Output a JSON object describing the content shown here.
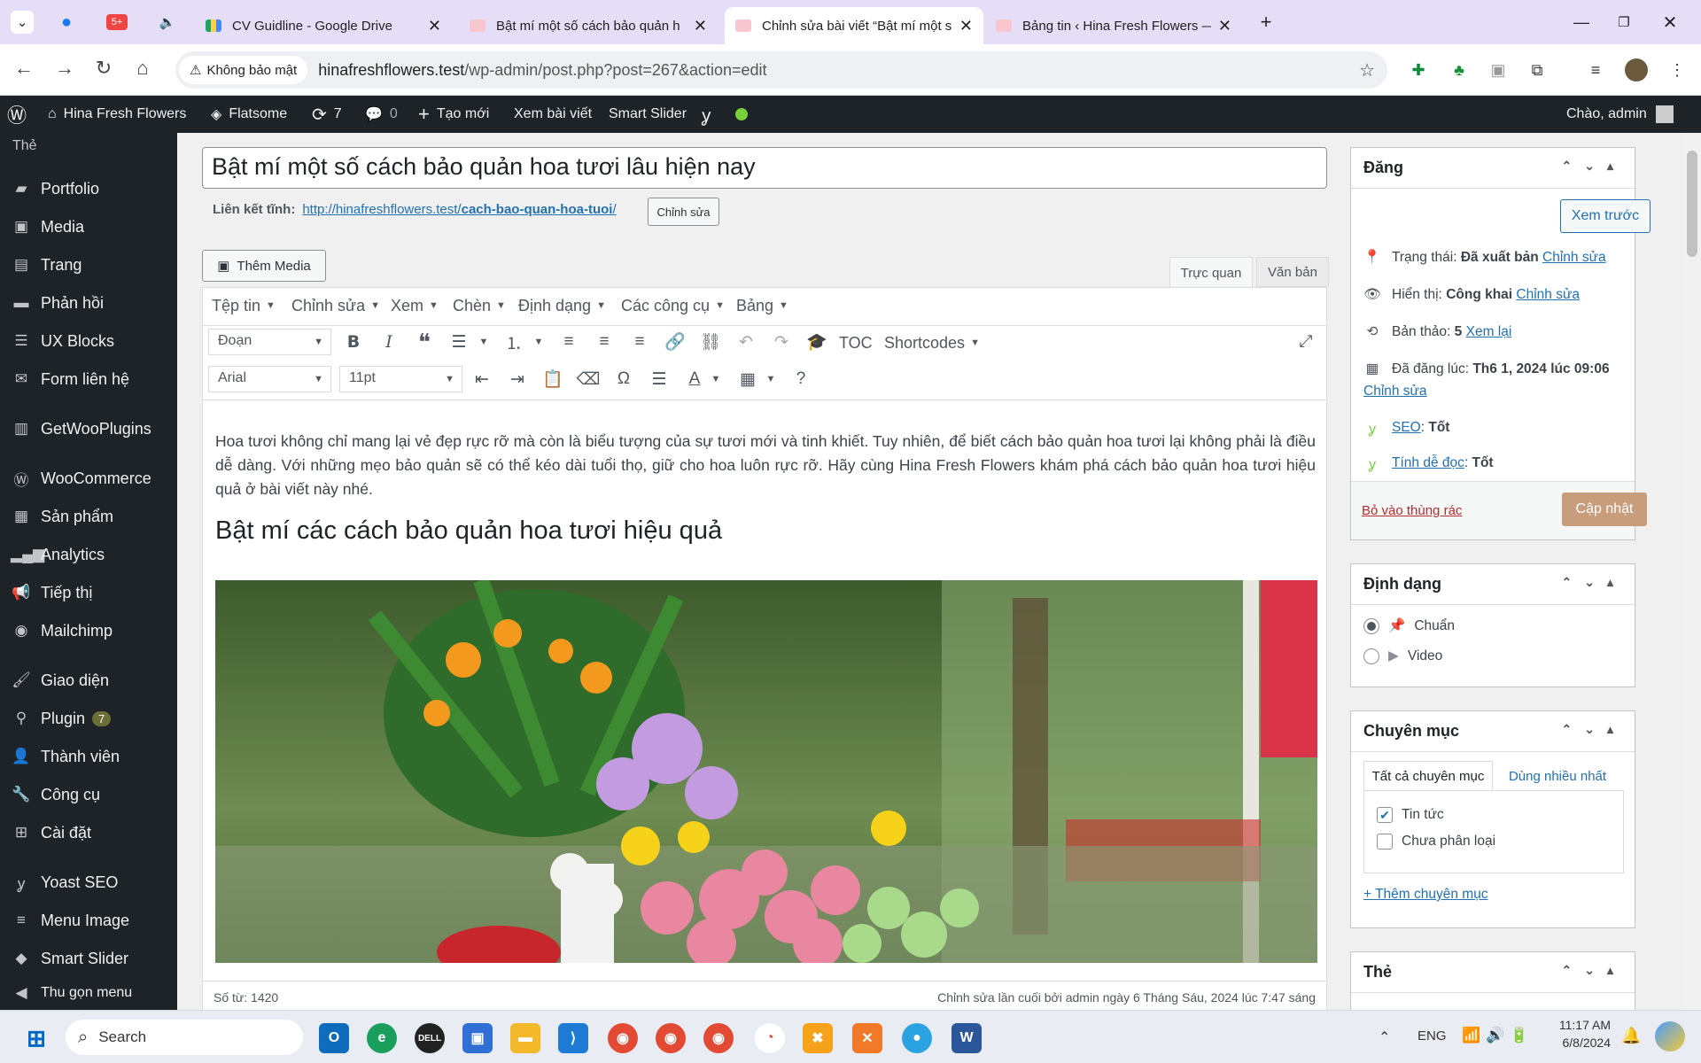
{
  "browser": {
    "tabs": [
      {
        "title": "CV Guidline - Google Drive"
      },
      {
        "title": "Bật mí một số cách bảo quản h"
      },
      {
        "title": "Chỉnh sửa bài viết “Bật mí một s"
      },
      {
        "title": "Bảng tin ‹ Hina Fresh Flowers —"
      }
    ],
    "tab_badge": "5+",
    "security_label": "Không bảo mật",
    "url_host": "hinafreshflowers.test",
    "url_path": "/wp-admin/post.php?post=267&action=edit"
  },
  "adminbar": {
    "site": "Hina Fresh Flowers",
    "theme": "Flatsome",
    "updates": "7",
    "comments": "0",
    "new": "Tạo mới",
    "view": "Xem bài viết",
    "slider": "Smart Slider",
    "greeting": "Chào, admin"
  },
  "sidebar": {
    "partial_top": "Thẻ",
    "items": [
      {
        "label": "Portfolio",
        "icon": "portfolio-icon"
      },
      {
        "label": "Media",
        "icon": "media-icon"
      },
      {
        "label": "Trang",
        "icon": "page-icon"
      },
      {
        "label": "Phản hồi",
        "icon": "comments-icon"
      },
      {
        "label": "UX Blocks",
        "icon": "blocks-icon"
      },
      {
        "label": "Form liên hệ",
        "icon": "mail-icon"
      },
      {
        "label": "GetWooPlugins",
        "icon": "chart-icon"
      },
      {
        "label": "WooCommerce",
        "icon": "woo-icon"
      },
      {
        "label": "Sản phẩm",
        "icon": "products-icon"
      },
      {
        "label": "Analytics",
        "icon": "analytics-icon"
      },
      {
        "label": "Tiếp thị",
        "icon": "megaphone-icon"
      },
      {
        "label": "Mailchimp",
        "icon": "mailchimp-icon"
      },
      {
        "label": "Giao diện",
        "icon": "brush-icon"
      },
      {
        "label": "Plugin",
        "icon": "plugin-icon",
        "badge": "7"
      },
      {
        "label": "Thành viên",
        "icon": "users-icon"
      },
      {
        "label": "Công cụ",
        "icon": "tools-icon"
      },
      {
        "label": "Cài đặt",
        "icon": "settings-icon"
      },
      {
        "label": "Yoast SEO",
        "icon": "yoast-icon"
      },
      {
        "label": "Menu Image",
        "icon": "menu-icon"
      },
      {
        "label": "Smart Slider",
        "icon": "slider-icon"
      },
      {
        "label": "Thu gọn menu",
        "icon": "collapse-icon"
      }
    ]
  },
  "post": {
    "title": "Bật mí một số cách bảo quản hoa tươi lâu hiện nay",
    "permalink_label": "Liên kết tĩnh:",
    "permalink_base": "http://hinafreshflowers.test/",
    "permalink_slug": "cach-bao-quan-hoa-tuoi",
    "permalink_end": "/",
    "edit_slug": "Chỉnh sửa",
    "add_media": "Thêm Media",
    "tab_visual": "Trực quan",
    "tab_text": "Văn bản",
    "menus": [
      "Tệp tin",
      "Chỉnh sửa",
      "Xem",
      "Chèn",
      "Định dạng",
      "Các công cụ",
      "Bảng"
    ],
    "format_select": "Đoạn",
    "font_select": "Arial",
    "size_select": "11pt",
    "toc": "TOC",
    "shortcodes": "Shortcodes",
    "paragraph": "Hoa tươi không chỉ mang lại vẻ đẹp rực rỡ mà còn là biểu tượng của sự tươi mới và tinh khiết. Tuy nhiên, để biết cách bảo quản hoa tươi lại không phải là điều dễ dàng. Với những mẹo bảo quản sẽ có thể kéo dài tuổi thọ, giữ cho hoa luôn rực rỡ. Hãy cùng Hina Fresh Flowers khám phá cách bảo quản hoa tươi hiệu quả ở bài viết này nhé.",
    "heading": "Bật mí các cách bảo quản hoa tươi hiệu quả",
    "word_count": "Số từ: 1420",
    "last_edit": "Chỉnh sửa lần cuối bởi admin ngày 6 Tháng Sáu, 2024 lúc 7:47 sáng"
  },
  "publish": {
    "title": "Đăng",
    "preview": "Xem trước",
    "status_label": "Trạng thái:",
    "status_value": "Đã xuất bản",
    "visibility_label": "Hiển thị:",
    "visibility_value": "Công khai",
    "revisions_label": "Bản thảo:",
    "revisions_value": "5",
    "revisions_link": "Xem lại",
    "published_label": "Đã đăng lúc:",
    "published_value": "Th6 1, 2024 lúc 09:06",
    "edit": "Chỉnh sửa",
    "seo_label": "SEO",
    "seo_value": "Tốt",
    "read_label": "Tính dễ đọc",
    "read_value": "Tốt",
    "trash": "Bỏ vào thùng rác",
    "update": "Cập nhật"
  },
  "format_box": {
    "title": "Định dạng",
    "options": [
      "Chuẩn",
      "Video"
    ]
  },
  "category_box": {
    "title": "Chuyên mục",
    "tab_all": "Tất cả chuyên mục",
    "tab_popular": "Dùng nhiều nhất",
    "items": [
      {
        "label": "Tin tức",
        "checked": true
      },
      {
        "label": "Chưa phân loại",
        "checked": false
      }
    ],
    "add": "+ Thêm chuyên mục"
  },
  "tags_box": {
    "title": "Thẻ"
  },
  "taskbar": {
    "search": "Search",
    "lang": "ENG",
    "time": "11:17 AM",
    "date": "6/8/2024"
  }
}
